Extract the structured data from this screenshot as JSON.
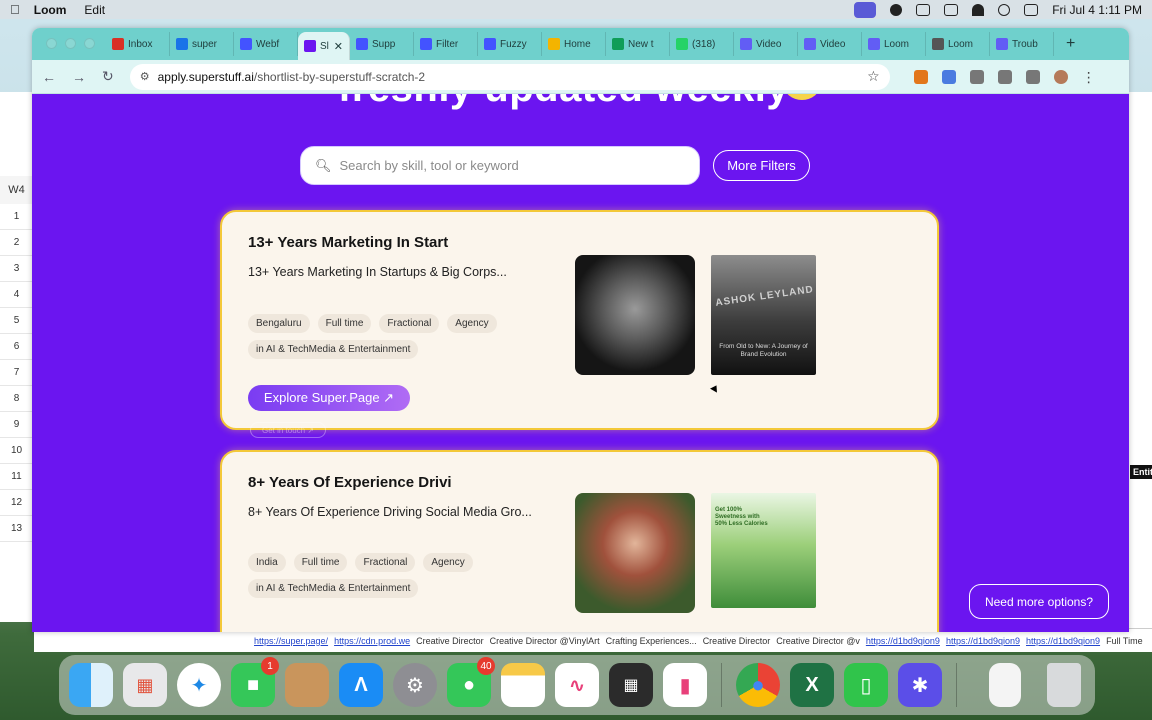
{
  "menubar": {
    "apple": "",
    "app_name": "Loom",
    "menu_edit": "Edit",
    "clock": "Fri Jul 4  1:11 PM"
  },
  "spreadsheet": {
    "name_box": "W4",
    "row_numbers": [
      "1",
      "2",
      "3",
      "4",
      "5",
      "6",
      "7",
      "8",
      "9",
      "10",
      "11",
      "12",
      "13"
    ],
    "bottom_cells": [
      "https://super.page/",
      "https://cdn.prod.we",
      "Creative Director",
      "Creative Director @VinylArt",
      "Crafting Experiences...",
      "Creative Director",
      "Creative Director @v",
      "https://d1bd9qion9",
      "https://d1bd9qion9",
      "https://d1bd9qion9",
      "Full Time"
    ],
    "right_header": "Entit"
  },
  "browser": {
    "tabs": [
      {
        "label": "Inbox",
        "fav": "#d93025"
      },
      {
        "label": "super",
        "fav": "#1a73e8"
      },
      {
        "label": "Webf",
        "fav": "#4353ff"
      },
      {
        "label": "Sl",
        "fav": "#6b15f0",
        "active": true
      },
      {
        "label": "Supp",
        "fav": "#4353ff"
      },
      {
        "label": "Filter",
        "fav": "#4353ff"
      },
      {
        "label": "Fuzzy",
        "fav": "#4353ff"
      },
      {
        "label": "Home",
        "fav": "#f4b400"
      },
      {
        "label": "New t",
        "fav": "#0f9d58"
      },
      {
        "label": "(318)",
        "fav": "#25d366"
      },
      {
        "label": "Video",
        "fav": "#625df5"
      },
      {
        "label": "Video",
        "fav": "#625df5"
      },
      {
        "label": "Loom",
        "fav": "#625df5"
      },
      {
        "label": "Loom",
        "fav": "#555555"
      },
      {
        "label": "Troub",
        "fav": "#625df5"
      }
    ],
    "new_tab": "+",
    "close_glyph": "✕",
    "url_host": "apply.superstuff.ai",
    "url_path": "/shortlist-by-superstuff-scratch-2"
  },
  "page": {
    "hero_text": "freshly updated weekly",
    "search_placeholder": "Search by skill, tool or keyword",
    "more_filters": "More Filters",
    "ghost_button": "Get in touch ↗",
    "need_more": "Need more options?",
    "cards": [
      {
        "title": "13+ Years Marketing In Start",
        "subtitle": "13+ Years Marketing In Startups & Big Corps...",
        "tags": [
          "Bengaluru",
          "Full time",
          "Fractional",
          "Agency"
        ],
        "industry": "in AI & TechMedia & Entertainment",
        "cta": "Explore Super.Page ↗",
        "work_caption": "From Old to New: A Journey of Brand Evolution",
        "work_brand": "ASHOK LEYLAND"
      },
      {
        "title": "8+ Years Of Experience Drivi",
        "subtitle": "8+ Years Of Experience Driving Social Media Gro...",
        "tags": [
          "India",
          "Full time",
          "Fractional",
          "Agency"
        ],
        "industry": "in AI & TechMedia & Entertainment",
        "work_caption": "Get 100% Sweetness with 50% Less Calories"
      }
    ]
  },
  "dock": {
    "facetime_badge": "1",
    "messages_badge": "40"
  }
}
